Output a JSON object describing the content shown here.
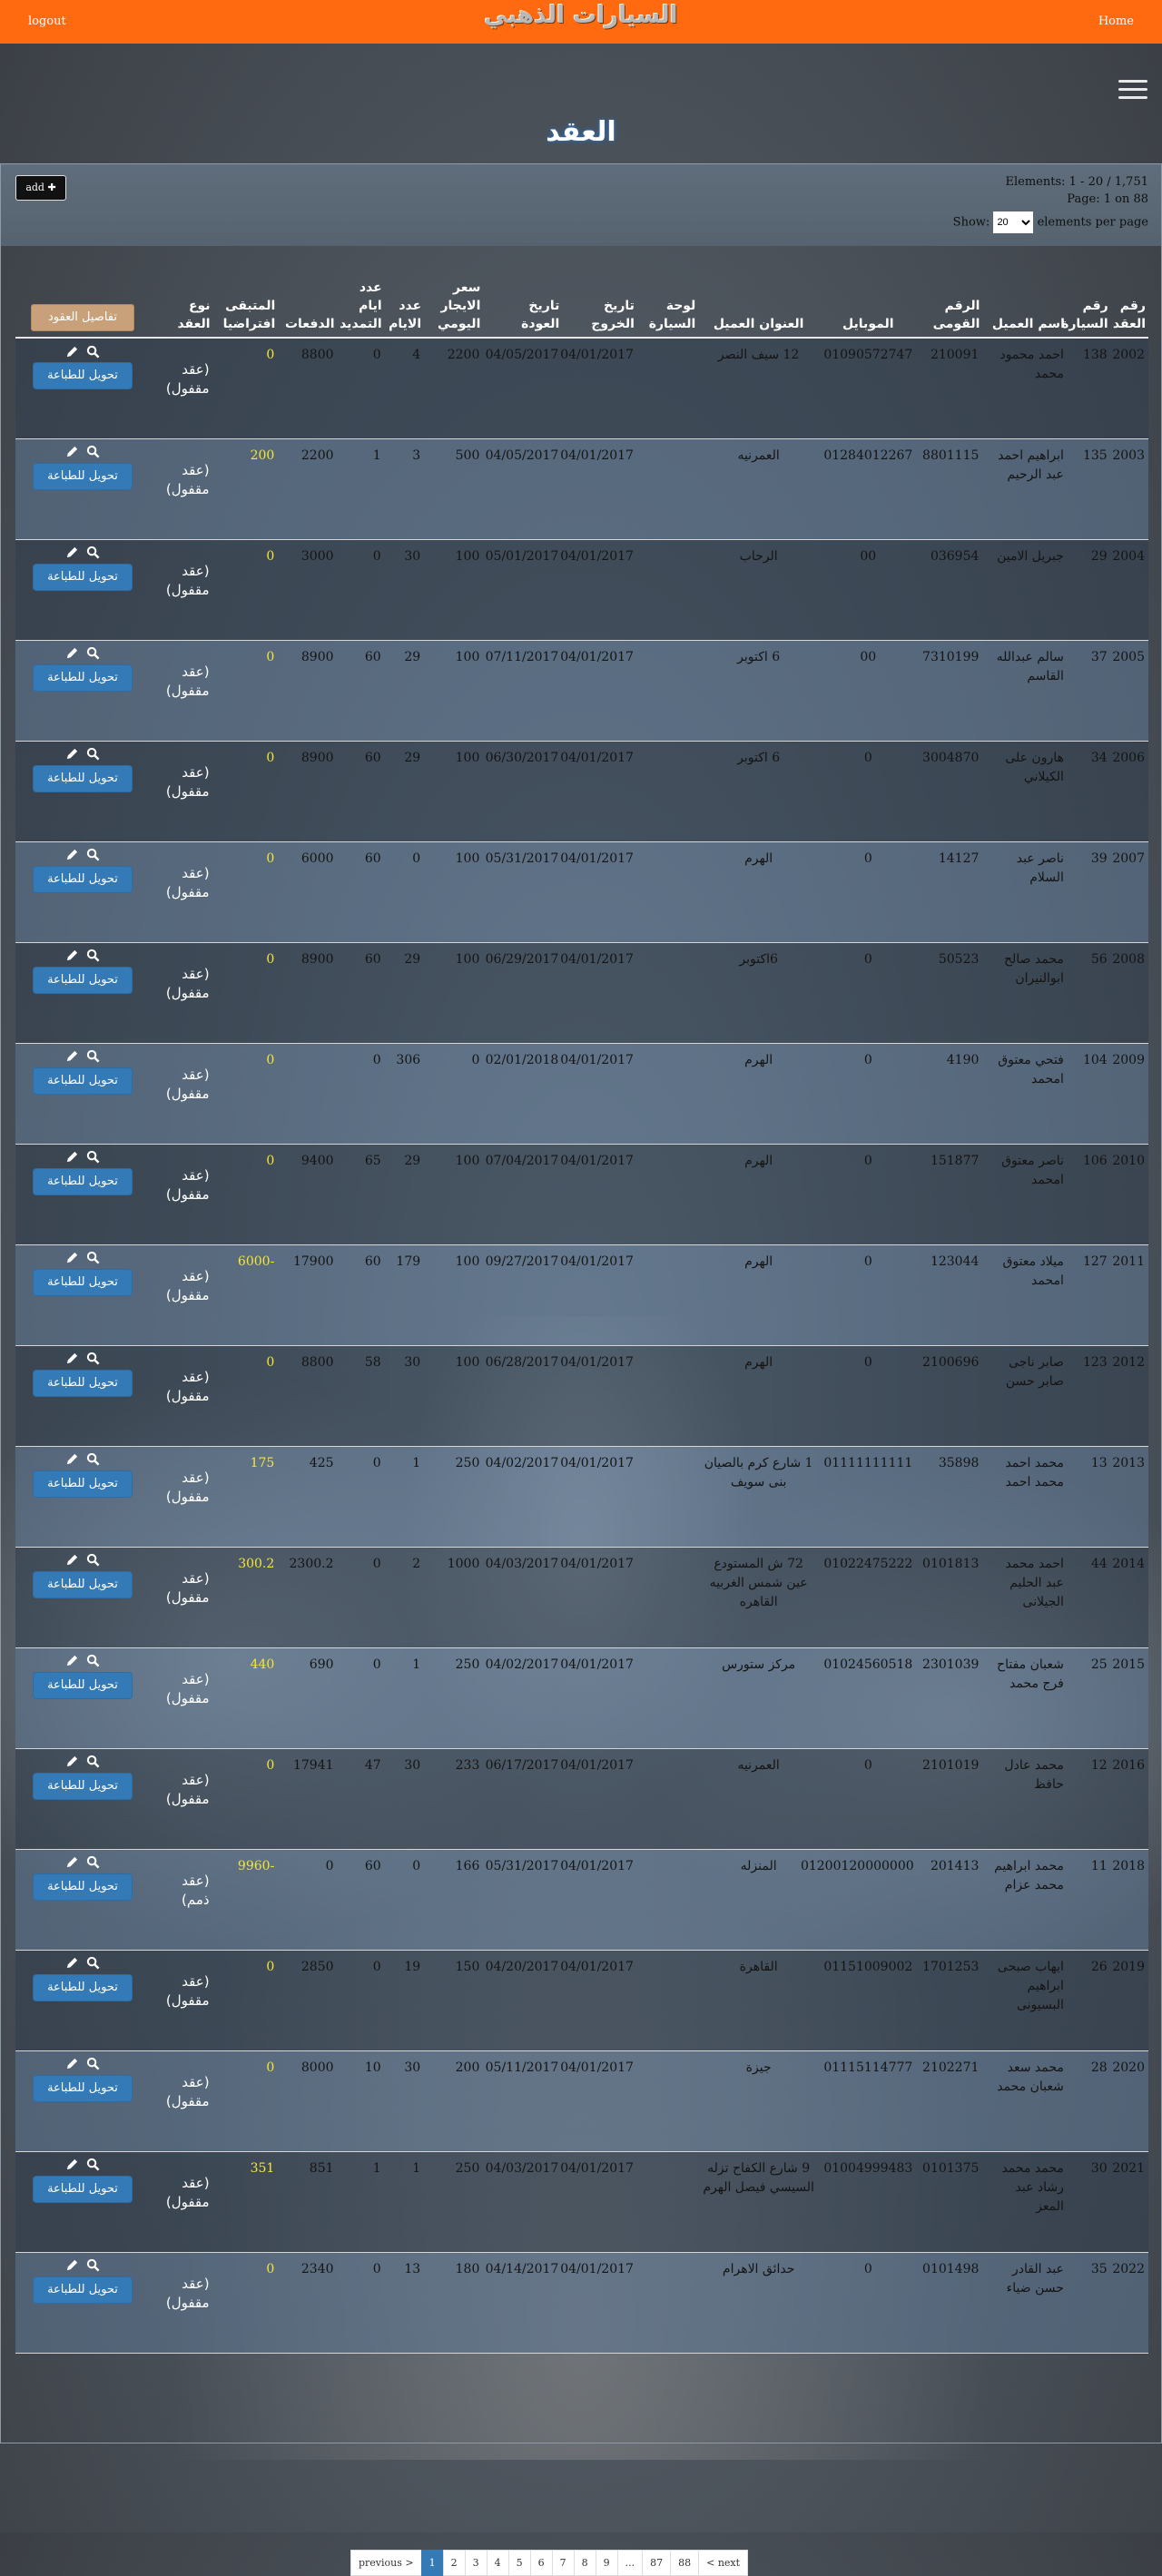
{
  "topbar": {
    "logout": "logout",
    "home": "Home",
    "logo_text": "السيارات الذهبي"
  },
  "page_title": "العقد",
  "toolbar": {
    "add_label": "add ✚",
    "elements_info": "Elements: 1 - 20 / 1,751",
    "page_info": "Page: 1 on 88",
    "show_label": "Show:",
    "per_page_value": "20",
    "per_page_suffix": "elements per page"
  },
  "table": {
    "headers": {
      "contract_no": "رقم العقد",
      "car_no": "رقم السيارة",
      "client_name": "اسم العميل",
      "national_id": "الرقم القومى",
      "mobile": "الموبايل",
      "address": "العنوان العميل",
      "plate": "لوحة السيارة",
      "exit_date": "تاريخ الخروج",
      "return_date": "تاريخ العودة",
      "daily_rate": "سعر الايجار اليومي",
      "days": "عدد الايام",
      "ext_days": "عدد ايام التمديد",
      "payments": "الدفعات",
      "remaining": "المتبقى افتراضيا",
      "contract_type": "نوع العقد",
      "details_button": "تفاصيل العقود"
    },
    "print_label": "تحويل للطباعة",
    "rows": [
      {
        "contract_no": "2002",
        "car_no": "138",
        "client_name": "احمد محمود محمد",
        "national_id": "210091",
        "mobile": "01090572747",
        "address": "12 سيف النصر",
        "plate": "",
        "exit_date": "04/01/2017",
        "return_date": "04/05/2017",
        "daily_rate": "2200",
        "days": "4",
        "ext_days": "0",
        "payments": "8800",
        "remaining": "0",
        "contract_type": "(عقد مقفول)"
      },
      {
        "contract_no": "2003",
        "car_no": "135",
        "client_name": "ابراهيم احمد عبد الرحيم",
        "national_id": "8801115",
        "mobile": "01284012267",
        "address": "العمرنيه",
        "plate": "",
        "exit_date": "04/01/2017",
        "return_date": "04/05/2017",
        "daily_rate": "500",
        "days": "3",
        "ext_days": "1",
        "payments": "2200",
        "remaining": "200",
        "contract_type": "(عقد مقفول)"
      },
      {
        "contract_no": "2004",
        "car_no": "29",
        "client_name": "جبريل الامين",
        "national_id": "036954",
        "mobile": "00",
        "address": "الرحاب",
        "plate": "",
        "exit_date": "04/01/2017",
        "return_date": "05/01/2017",
        "daily_rate": "100",
        "days": "30",
        "ext_days": "0",
        "payments": "3000",
        "remaining": "0",
        "contract_type": "(عقد مقفول)"
      },
      {
        "contract_no": "2005",
        "car_no": "37",
        "client_name": "سالم عبدالله القاسم",
        "national_id": "7310199",
        "mobile": "00",
        "address": "6 اكتوبر",
        "plate": "",
        "exit_date": "04/01/2017",
        "return_date": "07/11/2017",
        "daily_rate": "100",
        "days": "29",
        "ext_days": "60",
        "payments": "8900",
        "remaining": "0",
        "contract_type": "(عقد مقفول)"
      },
      {
        "contract_no": "2006",
        "car_no": "34",
        "client_name": "هارون على الكيلاني",
        "national_id": "3004870",
        "mobile": "0",
        "address": "6 اكتوبر",
        "plate": "",
        "exit_date": "04/01/2017",
        "return_date": "06/30/2017",
        "daily_rate": "100",
        "days": "29",
        "ext_days": "60",
        "payments": "8900",
        "remaining": "0",
        "contract_type": "(عقد مقفول)"
      },
      {
        "contract_no": "2007",
        "car_no": "39",
        "client_name": "ناصر عبد السلام",
        "national_id": "14127",
        "mobile": "0",
        "address": "الهرم",
        "plate": "",
        "exit_date": "04/01/2017",
        "return_date": "05/31/2017",
        "daily_rate": "100",
        "days": "0",
        "ext_days": "60",
        "payments": "6000",
        "remaining": "0",
        "contract_type": "(عقد مقفول)"
      },
      {
        "contract_no": "2008",
        "car_no": "56",
        "client_name": "محمد صالح ابوالنيران",
        "national_id": "50523",
        "mobile": "0",
        "address": "6اكتوبر",
        "plate": "",
        "exit_date": "04/01/2017",
        "return_date": "06/29/2017",
        "daily_rate": "100",
        "days": "29",
        "ext_days": "60",
        "payments": "8900",
        "remaining": "0",
        "contract_type": "(عقد مقفول)"
      },
      {
        "contract_no": "2009",
        "car_no": "104",
        "client_name": "فتحي معتوق امحمد",
        "national_id": "4190",
        "mobile": "0",
        "address": "الهرم",
        "plate": "",
        "exit_date": "04/01/2017",
        "return_date": "02/01/2018",
        "daily_rate": "0",
        "days": "306",
        "ext_days": "0",
        "payments": "",
        "remaining": "0",
        "contract_type": "(عقد مقفول)"
      },
      {
        "contract_no": "2010",
        "car_no": "106",
        "client_name": "ناصر معتوق امحمد",
        "national_id": "151877",
        "mobile": "0",
        "address": "الهرم",
        "plate": "",
        "exit_date": "04/01/2017",
        "return_date": "07/04/2017",
        "daily_rate": "100",
        "days": "29",
        "ext_days": "65",
        "payments": "9400",
        "remaining": "0",
        "contract_type": "(عقد مقفول)"
      },
      {
        "contract_no": "2011",
        "car_no": "127",
        "client_name": "ميلاد معتوق امحمد",
        "national_id": "123044",
        "mobile": "0",
        "address": "الهرم",
        "plate": "",
        "exit_date": "04/01/2017",
        "return_date": "09/27/2017",
        "daily_rate": "100",
        "days": "179",
        "ext_days": "60",
        "payments": "17900",
        "remaining": "-6000",
        "contract_type": "(عقد مقفول)"
      },
      {
        "contract_no": "2012",
        "car_no": "123",
        "client_name": "صابر ناجى صابر حسن",
        "national_id": "2100696",
        "mobile": "0",
        "address": "الهرم",
        "plate": "",
        "exit_date": "04/01/2017",
        "return_date": "06/28/2017",
        "daily_rate": "100",
        "days": "30",
        "ext_days": "58",
        "payments": "8800",
        "remaining": "0",
        "contract_type": "(عقد مقفول)"
      },
      {
        "contract_no": "2013",
        "car_no": "13",
        "client_name": "محمد احمد محمد احمد",
        "national_id": "35898",
        "mobile": "01111111111",
        "address": "1 شارع كرم بالصيان بنى سويف",
        "plate": "",
        "exit_date": "04/01/2017",
        "return_date": "04/02/2017",
        "daily_rate": "250",
        "days": "1",
        "ext_days": "0",
        "payments": "425",
        "remaining": "175",
        "contract_type": "(عقد مقفول)"
      },
      {
        "contract_no": "2014",
        "car_no": "44",
        "client_name": "احمد محمد عبد الحليم الجيلانى",
        "national_id": "0101813",
        "mobile": "01022475222",
        "address": "72 ش المستودع عين شمس الغربيه القاهره",
        "plate": "",
        "exit_date": "04/01/2017",
        "return_date": "04/03/2017",
        "daily_rate": "1000",
        "days": "2",
        "ext_days": "0",
        "payments": "2300.2",
        "remaining": "300.2",
        "contract_type": "(عقد مقفول)"
      },
      {
        "contract_no": "2015",
        "car_no": "25",
        "client_name": "شعبان مفتاح فرج محمد",
        "national_id": "2301039",
        "mobile": "01024560518",
        "address": "مركز ستورس",
        "plate": "",
        "exit_date": "04/01/2017",
        "return_date": "04/02/2017",
        "daily_rate": "250",
        "days": "1",
        "ext_days": "0",
        "payments": "690",
        "remaining": "440",
        "contract_type": "(عقد مقفول)"
      },
      {
        "contract_no": "2016",
        "car_no": "12",
        "client_name": "محمد عادل حافظ",
        "national_id": "2101019",
        "mobile": "0",
        "address": "العمرنيه",
        "plate": "",
        "exit_date": "04/01/2017",
        "return_date": "06/17/2017",
        "daily_rate": "233",
        "days": "30",
        "ext_days": "47",
        "payments": "17941",
        "remaining": "0",
        "contract_type": "(عقد مقفول)"
      },
      {
        "contract_no": "2018",
        "car_no": "11",
        "client_name": "محمد ابراهيم محمد عزام",
        "national_id": "201413",
        "mobile": "01200120000000",
        "address": "المنزله",
        "plate": "",
        "exit_date": "04/01/2017",
        "return_date": "05/31/2017",
        "daily_rate": "166",
        "days": "0",
        "ext_days": "60",
        "payments": "0",
        "remaining": "-9960",
        "contract_type": "(عقد ذمم)"
      },
      {
        "contract_no": "2019",
        "car_no": "26",
        "client_name": "ايهاب صبحى ابراهيم البسيونى",
        "national_id": "1701253",
        "mobile": "01151009002",
        "address": "القاهرة",
        "plate": "",
        "exit_date": "04/01/2017",
        "return_date": "04/20/2017",
        "daily_rate": "150",
        "days": "19",
        "ext_days": "0",
        "payments": "2850",
        "remaining": "0",
        "contract_type": "(عقد مقفول)"
      },
      {
        "contract_no": "2020",
        "car_no": "28",
        "client_name": "محمد سعد شعبان محمد",
        "national_id": "2102271",
        "mobile": "01115114777",
        "address": "جيزة",
        "plate": "",
        "exit_date": "04/01/2017",
        "return_date": "05/11/2017",
        "daily_rate": "200",
        "days": "30",
        "ext_days": "10",
        "payments": "8000",
        "remaining": "0",
        "contract_type": "(عقد مقفول)"
      },
      {
        "contract_no": "2021",
        "car_no": "30",
        "client_name": "محمد محمد رشاد عبد المعز",
        "national_id": "0101375",
        "mobile": "01004999483",
        "address": "9 شارع الكفاح تزله السيسي فيصل الهرم",
        "plate": "",
        "exit_date": "04/01/2017",
        "return_date": "04/03/2017",
        "daily_rate": "250",
        "days": "1",
        "ext_days": "1",
        "payments": "851",
        "remaining": "351",
        "contract_type": "(عقد مقفول)"
      },
      {
        "contract_no": "2022",
        "car_no": "35",
        "client_name": "عبد القادر حسن ضياء",
        "national_id": "0101498",
        "mobile": "0",
        "address": "حدائق الاهرام",
        "plate": "",
        "exit_date": "04/01/2017",
        "return_date": "04/14/2017",
        "daily_rate": "180",
        "days": "13",
        "ext_days": "0",
        "payments": "2340",
        "remaining": "0",
        "contract_type": "(عقد مقفول)"
      }
    ]
  },
  "pagination": {
    "items": [
      "previous >",
      "1",
      "2",
      "3",
      "4",
      "5",
      "6",
      "7",
      "8",
      "9",
      "...",
      "87",
      "88",
      "< next"
    ],
    "active": "1"
  }
}
